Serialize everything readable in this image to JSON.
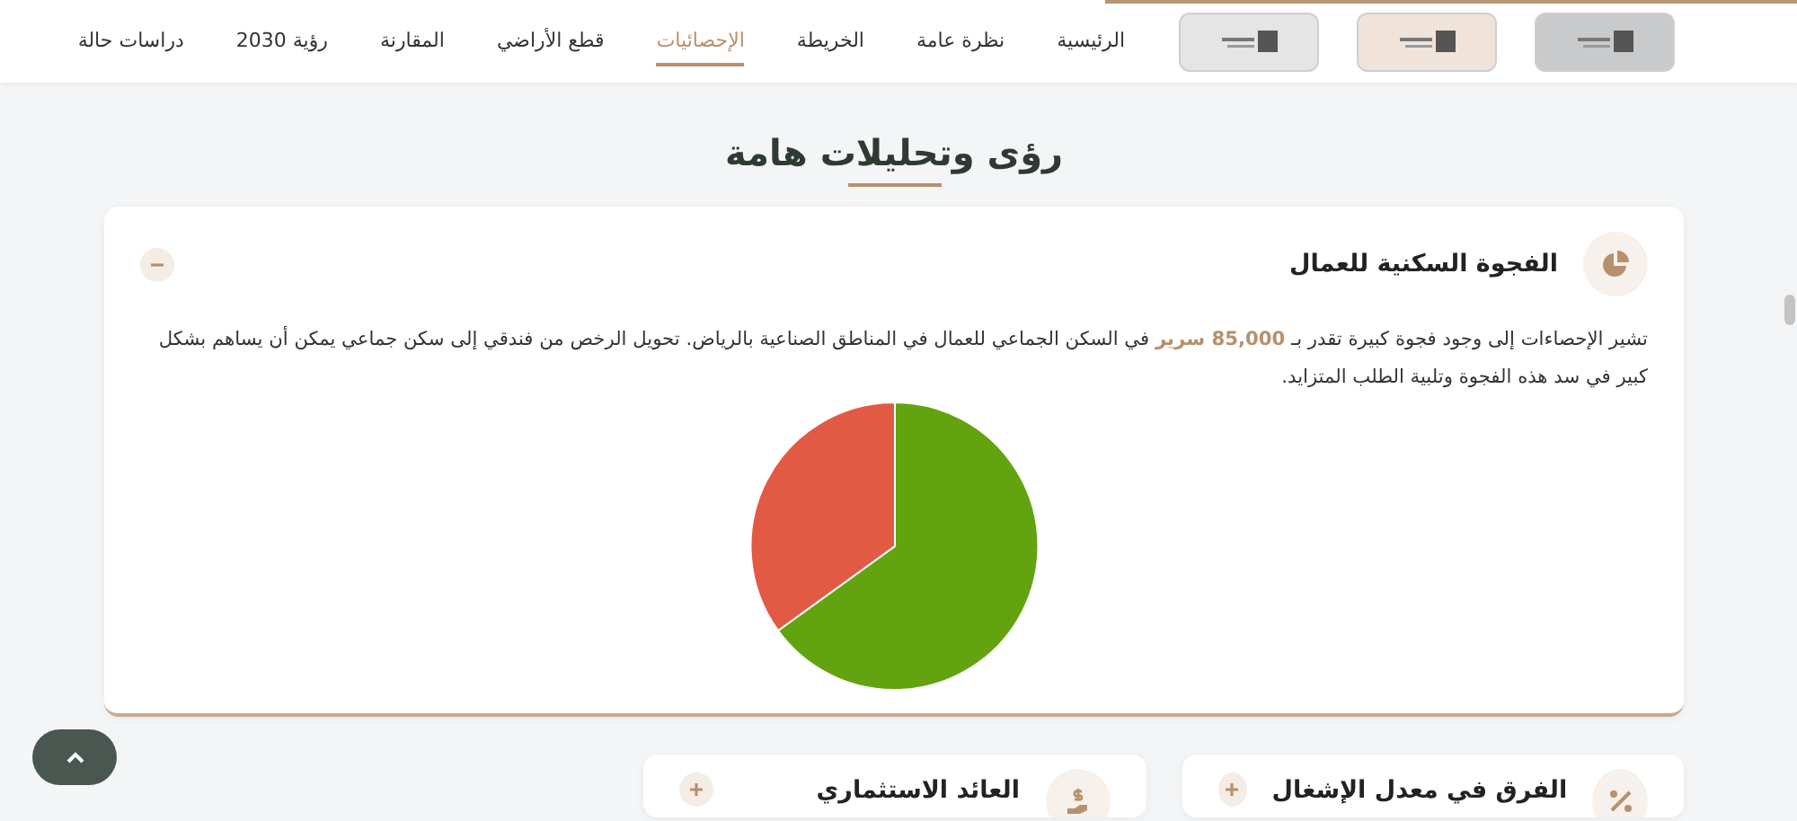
{
  "header": {
    "logos": [
      {
        "color": "#c9cacb"
      },
      {
        "color": "#efe3da"
      },
      {
        "color": "#e4e5e4"
      }
    ],
    "nav": [
      {
        "label": "الرئيسية",
        "selected": false
      },
      {
        "label": "نظرة عامة",
        "selected": false
      },
      {
        "label": "الخريطة",
        "selected": false
      },
      {
        "label": "الإحصائيات",
        "selected": true
      },
      {
        "label": "قطع الأراضي",
        "selected": false
      },
      {
        "label": "المقارنة",
        "selected": false
      },
      {
        "label": "رؤية 2030",
        "selected": false
      },
      {
        "label": "دراسات حالة",
        "selected": false
      }
    ]
  },
  "section_title": "رؤى وتحليلات هامة",
  "insights": [
    {
      "title": "الفجوة السكنية للعمال",
      "expanded": true,
      "kind": "pie",
      "description": "تشير الإحصاءات إلى وجود فجوة كبيرة تقدر بـ **85,000 سرير** في السكن الجماعي للعمال في المناطق الصناعية بالرياض. تحويل الرخص من فندقي إلى سكن جماعي يمكن أن يساهم بشكل كبير في سد هذه الفجوة وتلبية الطلب المتزايد."
    }
  ],
  "more_insights": [
    {
      "title": "الفرق في معدل الإشغال",
      "expanded": false,
      "kind": "percent"
    },
    {
      "title": "العائد الاستثماري",
      "expanded": false,
      "kind": "money"
    }
  ]
}
